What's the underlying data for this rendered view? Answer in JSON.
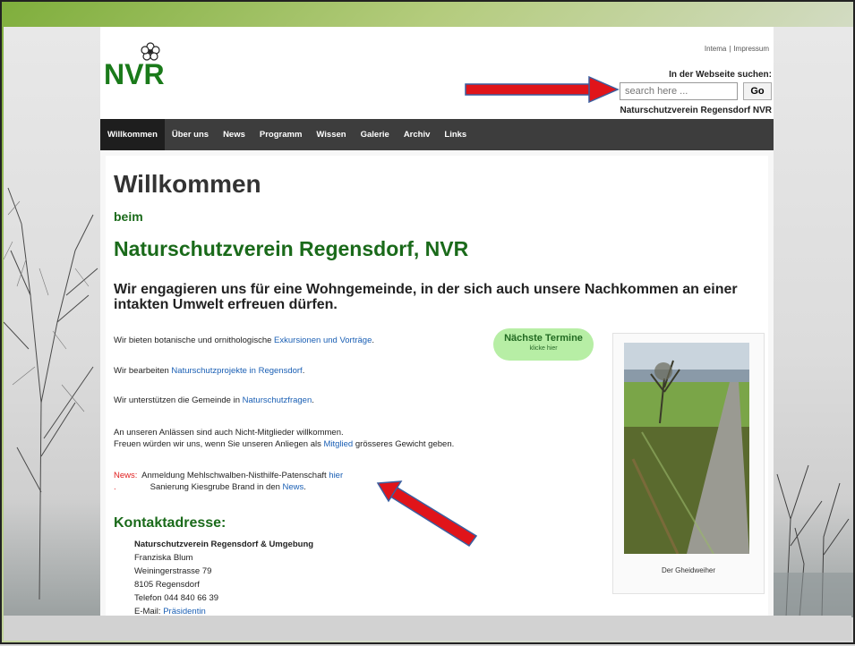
{
  "top_links": [
    "Intema",
    "Impressum"
  ],
  "search": {
    "label": "In der Webseite suchen:",
    "placeholder": "search here ...",
    "button": "Go"
  },
  "site_name": "Naturschutzverein Regensdorf NVR",
  "logo_text": "NVR",
  "nav": {
    "items": [
      "Willkommen",
      "Über uns",
      "News",
      "Programm",
      "Wissen",
      "Galerie",
      "Archiv",
      "Links"
    ],
    "active": "Willkommen"
  },
  "main": {
    "title": "Willkommen",
    "beim": "beim",
    "org": "Naturschutzverein Regensdorf, NVR",
    "mission": "Wir engagieren uns für eine Wohngemeinde, in der sich auch unsere Nachkommen an einer intakten Umwelt erfreuen dürfen.",
    "p1": {
      "text": "Wir bieten botanische und ornithologische ",
      "link": "Exkursionen und Vorträge",
      "end": "."
    },
    "p2": {
      "text": "Wir bearbeiten ",
      "link": "Naturschutzprojekte in Regensdorf",
      "end": "."
    },
    "p3": {
      "text": "Wir unterstützen die Gemeinde in ",
      "link": "Naturschutzfragen",
      "end": "."
    },
    "p4": {
      "line1": "An unseren Anlässen sind auch Nicht-Mitglieder willkommen.",
      "line2a": "Freuen würden wir uns, wenn Sie unseren Anliegen als ",
      "link": "Mitglied",
      "line2b": " grösseres Gewicht geben."
    },
    "news": {
      "label": "News:",
      "item1": "Anmeldung Mehlschwalben-Nisthilfe-Patenschaft ",
      "item1_link": "hier",
      "dot": ".",
      "item2": "Sanierung Kiesgrube Brand in den ",
      "item2_link": "News",
      "item2_end": "."
    },
    "termine": {
      "title": "Nächste Termine",
      "sub": "klicke hier"
    },
    "photo_caption": "Der Gheidweiher",
    "contact": {
      "heading": "Kontaktadresse:",
      "org": "Naturschutzverein Regensdorf & Umgebung",
      "name": "Franziska Blum",
      "street": "Weiningerstrasse 79",
      "city": "8105 Regensdorf",
      "phone": "Telefon 044 840 66 39",
      "email_label": "E-Mail: ",
      "email_link": "Präsidentin"
    }
  },
  "colors": {
    "green": "#1a6a1a",
    "link": "#1a5fb4",
    "nav": "#3d3d3d",
    "arrow": "#e0141a"
  }
}
